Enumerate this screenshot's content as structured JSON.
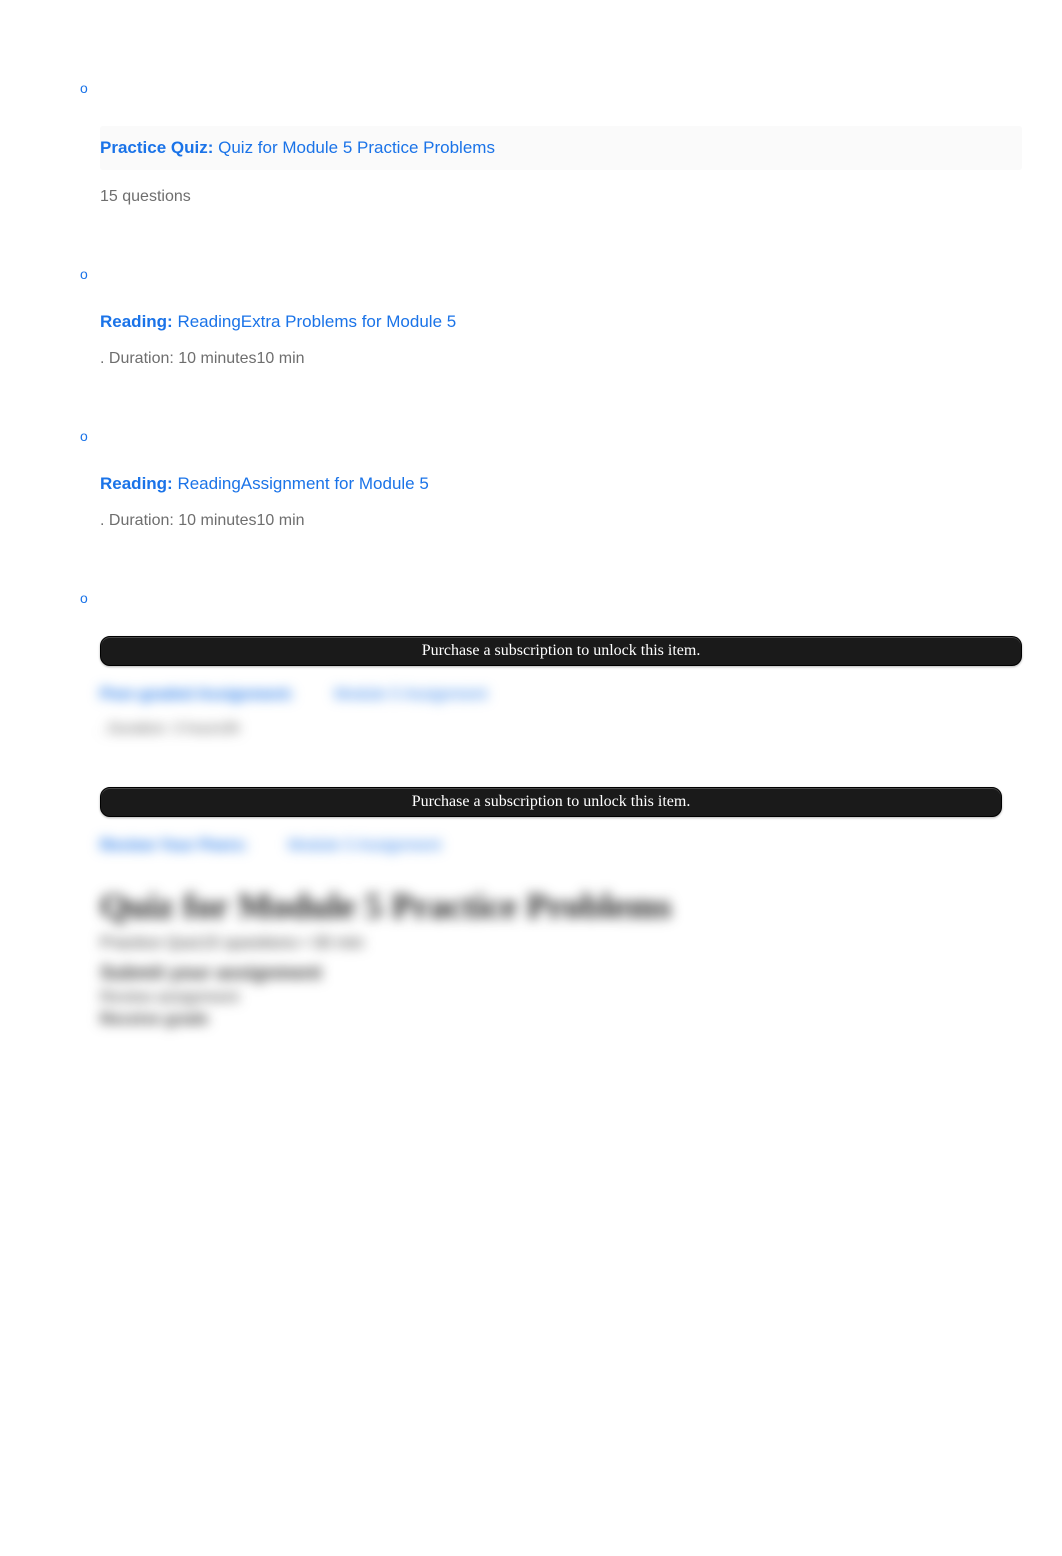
{
  "items": [
    {
      "prefix": "Practice Quiz: ",
      "title": "Quiz for Module 5 Practice Problems",
      "meta": "15 questions"
    },
    {
      "prefix": "Reading: ",
      "title": "ReadingExtra Problems for Module 5",
      "meta": ". Duration: 10 minutes10 min"
    },
    {
      "prefix": "Reading: ",
      "title": "ReadingAssignment for Module 5",
      "meta": ". Duration: 10 minutes10 min"
    }
  ],
  "locked": {
    "banner": "Purchase a subscription to unlock this item.",
    "item1_prefix": "Peer-graded Assignment: ",
    "item1_title": "Module 5 Assignment",
    "item1_meta": ". Duration: 3 hours3h",
    "item2_prefix": "Review Your Peers: ",
    "item2_title": "Module 5 Assignment",
    "heading": "Quiz for Module 5 Practice Problems",
    "sub": "Practice Quiz15 questions      •  30 min",
    "line1": "Submit your assignment",
    "line2": "Review assignment",
    "line3": "Receive grade"
  }
}
